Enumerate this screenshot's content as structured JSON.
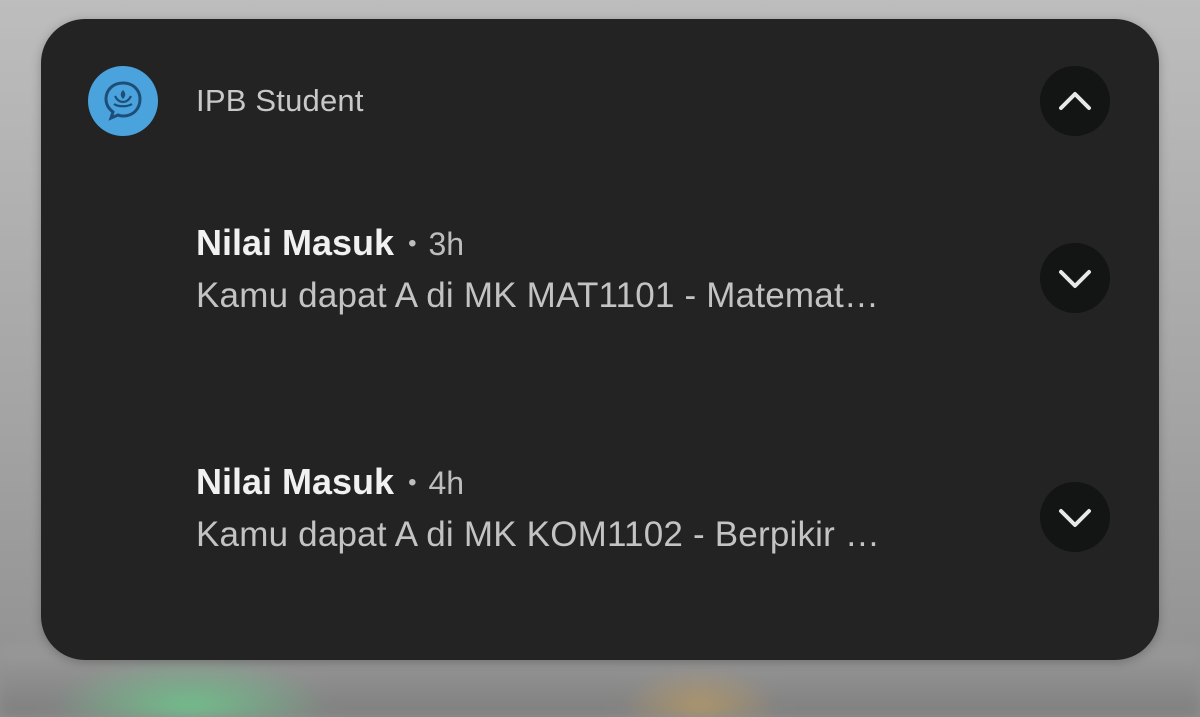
{
  "app": {
    "name": "IPB Student",
    "icon": "ipb-logo-icon",
    "icon_color": "#4aa3dc"
  },
  "group_toggle": {
    "icon": "chevron-up-icon",
    "state": "expanded"
  },
  "notifications": [
    {
      "title": "Nilai Masuk",
      "separator": "•",
      "time": "3h",
      "body": "Kamu dapat A di MK MAT1101 - Matemat…",
      "expand_icon": "chevron-down-icon"
    },
    {
      "title": "Nilai Masuk",
      "separator": "•",
      "time": "4h",
      "body": "Kamu dapat A di MK KOM1102 - Berpikir …",
      "expand_icon": "chevron-down-icon"
    }
  ],
  "colors": {
    "card_background": "#232323",
    "button_background": "#131414",
    "title_text": "#f1f1f1",
    "secondary_text": "#c3c3c3"
  }
}
